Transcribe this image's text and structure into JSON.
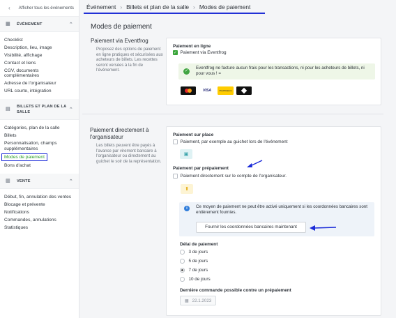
{
  "sidebar": {
    "back_label": "Afficher tous les événements",
    "sections": [
      {
        "title": "ÉVÉNEMENT",
        "items": [
          "Checklist",
          "Description, lieu, image",
          "Visibilité, affichage",
          "Contact et liens",
          "CGV, documents complémentaires",
          "Adresse de l'organisateur",
          "URL courte, intégration"
        ]
      },
      {
        "title": "BILLETS ET PLAN DE LA SALLE",
        "items": [
          "Catégories, plan de la salle",
          "Billets",
          "Personnalisation, champs supplémentaires",
          "Modes de paiement",
          "Bons d'achat"
        ],
        "active": "Modes de paiement"
      },
      {
        "title": "VENTE",
        "items": [
          "Début, fin, annulation des ventes",
          "Blocage et prévente",
          "Notifications",
          "Commandes, annulations",
          "Statistiques"
        ]
      }
    ]
  },
  "breadcrumb": {
    "items": [
      "Événement",
      "Billets et plan de la salle",
      "Modes de paiement"
    ]
  },
  "page_title": "Modes de paiement",
  "eventfrog": {
    "title": "Paiement via Eventfrog",
    "description": "Proposez des options de paiement en ligne pratiques et sécurisées aux acheteurs de billets. Les recettes seront versées à la fin de l'événement.",
    "online_heading": "Paiement en ligne",
    "online_checkbox": "Paiement via Eventfrog",
    "online_checked": true,
    "notice": "Eventfrog ne facture aucun frais pour les transactions, ni pour les acheteurs de billets, ni pour vous ! =",
    "logos": [
      "mastercard",
      "VISA",
      "PostFinance",
      "TWINT"
    ]
  },
  "direct": {
    "title": "Paiement directement à l'organisateur",
    "description": "Les billets peuvent être payés à l'avance par virement bancaire à l'organisateur ou directement au guichet le soir de la représentation.",
    "onsite_heading": "Paiement sur place",
    "onsite_checkbox": "Paiement, par exemple au guichet lors de l'événement",
    "prepay_heading": "Paiement par prépaiement",
    "prepay_checkbox": "Paiement directement sur le compte de l'organisateur.",
    "info": "Ce moyen de paiement ne peut être activé uniquement si les coordonnées bancaires sont entièrement fournies.",
    "bank_button": "Fournir les coordonnées bancaires maintenant",
    "deadline_heading": "Délai de paiement",
    "deadline_options": [
      "3 de jours",
      "5 de jours",
      "7 de jours",
      "10 de jours"
    ],
    "deadline_selected": "7 de jours",
    "last_order_heading": "Dernière commande possible contre un prépaiement",
    "last_order_date": "22.1.2023"
  },
  "colors": {
    "accent_green": "#3aa53a",
    "annotation_blue": "#1b2bd8"
  }
}
